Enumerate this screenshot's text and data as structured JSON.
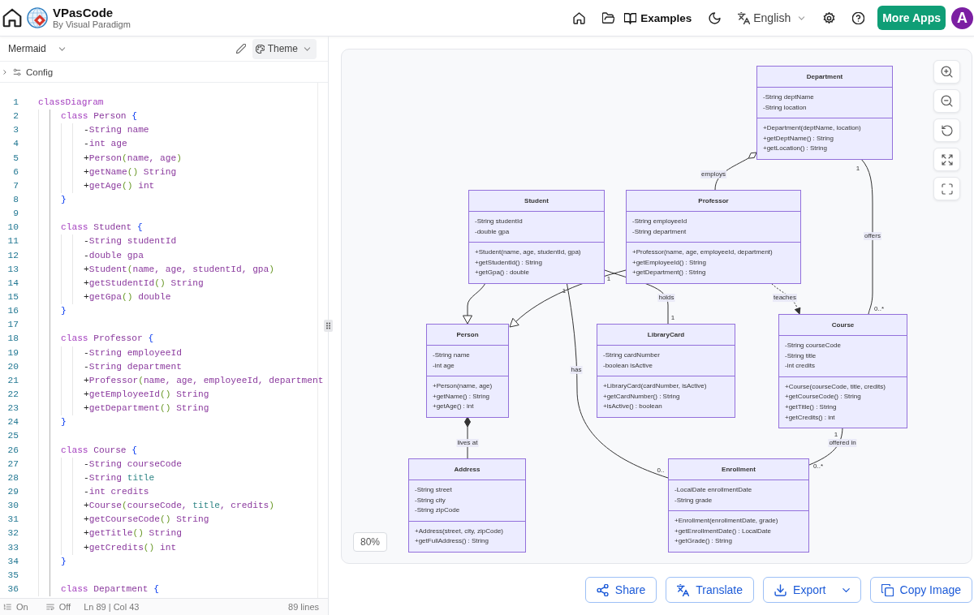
{
  "header": {
    "app_name": "VPasCode",
    "byline": "By Visual Paradigm",
    "examples": "Examples",
    "language": "English",
    "more_apps": "More Apps",
    "avatar": "A"
  },
  "editor": {
    "syntax": "Mermaid",
    "theme": "Theme",
    "config": {
      "label": "Config",
      "expanded": false
    },
    "lines": [
      {
        "number": "1",
        "tokens": [
          {
            "kind": "keyword",
            "text": "classDiagram"
          }
        ],
        "children": [
          {
            "number": "2",
            "tokens": [
              {
                "kind": "keyword",
                "text": "class"
              },
              {
                "kind": "identifier",
                "text": " Person "
              },
              {
                "kind": "brace",
                "text": "{"
              }
            ],
            "children": [
              {
                "number": "3",
                "tokens": [
                  {
                    "kind": "operator",
                    "text": "-"
                  },
                  {
                    "kind": "identifier",
                    "text": "String name"
                  }
                ]
              },
              {
                "number": "4",
                "tokens": [
                  {
                    "kind": "operator",
                    "text": "-"
                  },
                  {
                    "kind": "identifier",
                    "text": "int age"
                  }
                ]
              },
              {
                "number": "5",
                "tokens": [
                  {
                    "kind": "operator",
                    "text": "+"
                  },
                  {
                    "kind": "identifier",
                    "text": "Person"
                  },
                  {
                    "kind": "paren",
                    "text": "("
                  },
                  {
                    "kind": "identifier",
                    "text": "name, age"
                  },
                  {
                    "kind": "paren",
                    "text": ")"
                  }
                ]
              },
              {
                "number": "6",
                "tokens": [
                  {
                    "kind": "operator",
                    "text": "+"
                  },
                  {
                    "kind": "identifier",
                    "text": "getName"
                  },
                  {
                    "kind": "paren",
                    "text": "()"
                  },
                  {
                    "kind": "identifier",
                    "text": " String"
                  }
                ]
              },
              {
                "number": "7",
                "tokens": [
                  {
                    "kind": "operator",
                    "text": "+"
                  },
                  {
                    "kind": "identifier",
                    "text": "getAge"
                  },
                  {
                    "kind": "paren",
                    "text": "()"
                  },
                  {
                    "kind": "identifier",
                    "text": " int"
                  }
                ]
              }
            ]
          },
          {
            "number": "8",
            "tokens": [
              {
                "kind": "brace",
                "text": "}"
              }
            ]
          },
          {
            "number": "9"
          },
          {
            "number": "10",
            "tokens": [
              {
                "kind": "keyword",
                "text": "class"
              },
              {
                "kind": "identifier",
                "text": " Student "
              },
              {
                "kind": "brace",
                "text": "{"
              }
            ],
            "children": [
              {
                "number": "11",
                "tokens": [
                  {
                    "kind": "operator",
                    "text": "-"
                  },
                  {
                    "kind": "identifier",
                    "text": "String studentId"
                  }
                ]
              },
              {
                "number": "12",
                "tokens": [
                  {
                    "kind": "operator",
                    "text": "-"
                  },
                  {
                    "kind": "identifier",
                    "text": "double gpa"
                  }
                ]
              },
              {
                "number": "13",
                "tokens": [
                  {
                    "kind": "operator",
                    "text": "+"
                  },
                  {
                    "kind": "identifier",
                    "text": "Student"
                  },
                  {
                    "kind": "paren",
                    "text": "("
                  },
                  {
                    "kind": "identifier",
                    "text": "name, age, studentId, gpa"
                  },
                  {
                    "kind": "paren",
                    "text": ")"
                  }
                ]
              },
              {
                "number": "14",
                "tokens": [
                  {
                    "kind": "operator",
                    "text": "+"
                  },
                  {
                    "kind": "identifier",
                    "text": "getStudentId"
                  },
                  {
                    "kind": "paren",
                    "text": "()"
                  },
                  {
                    "kind": "identifier",
                    "text": " String"
                  }
                ]
              },
              {
                "number": "15",
                "tokens": [
                  {
                    "kind": "operator",
                    "text": "+"
                  },
                  {
                    "kind": "identifier",
                    "text": "getGpa"
                  },
                  {
                    "kind": "paren",
                    "text": "()"
                  },
                  {
                    "kind": "identifier",
                    "text": " double"
                  }
                ]
              }
            ]
          },
          {
            "number": "16",
            "tokens": [
              {
                "kind": "brace",
                "text": "}"
              }
            ]
          },
          {
            "number": "17"
          },
          {
            "number": "18",
            "tokens": [
              {
                "kind": "keyword",
                "text": "class"
              },
              {
                "kind": "identifier",
                "text": " Professor "
              },
              {
                "kind": "brace",
                "text": "{"
              }
            ],
            "children": [
              {
                "number": "19",
                "tokens": [
                  {
                    "kind": "operator",
                    "text": "-"
                  },
                  {
                    "kind": "identifier",
                    "text": "String employeeId"
                  }
                ]
              },
              {
                "number": "20",
                "tokens": [
                  {
                    "kind": "operator",
                    "text": "-"
                  },
                  {
                    "kind": "identifier",
                    "text": "String department"
                  }
                ]
              },
              {
                "number": "21",
                "tokens": [
                  {
                    "kind": "operator",
                    "text": "+"
                  },
                  {
                    "kind": "identifier",
                    "text": "Professor"
                  },
                  {
                    "kind": "paren",
                    "text": "("
                  },
                  {
                    "kind": "identifier",
                    "text": "name, age, employeeId, department"
                  }
                ]
              },
              {
                "number": "22",
                "tokens": [
                  {
                    "kind": "operator",
                    "text": "+"
                  },
                  {
                    "kind": "identifier",
                    "text": "getEmployeeId"
                  },
                  {
                    "kind": "paren",
                    "text": "()"
                  },
                  {
                    "kind": "identifier",
                    "text": " String"
                  }
                ]
              },
              {
                "number": "23",
                "tokens": [
                  {
                    "kind": "operator",
                    "text": "+"
                  },
                  {
                    "kind": "identifier",
                    "text": "getDepartment"
                  },
                  {
                    "kind": "paren",
                    "text": "()"
                  },
                  {
                    "kind": "identifier",
                    "text": " String"
                  }
                ]
              }
            ]
          },
          {
            "number": "24",
            "tokens": [
              {
                "kind": "brace",
                "text": "}"
              }
            ]
          },
          {
            "number": "25"
          },
          {
            "number": "26",
            "tokens": [
              {
                "kind": "keyword",
                "text": "class"
              },
              {
                "kind": "identifier",
                "text": " Course "
              },
              {
                "kind": "brace",
                "text": "{"
              }
            ],
            "children": [
              {
                "number": "27",
                "tokens": [
                  {
                    "kind": "operator",
                    "text": "-"
                  },
                  {
                    "kind": "identifier",
                    "text": "String courseCode"
                  }
                ]
              },
              {
                "number": "28",
                "tokens": [
                  {
                    "kind": "operator",
                    "text": "-"
                  },
                  {
                    "kind": "identifier",
                    "text": "String "
                  },
                  {
                    "kind": "property",
                    "text": "title"
                  }
                ]
              },
              {
                "number": "29",
                "tokens": [
                  {
                    "kind": "operator",
                    "text": "-"
                  },
                  {
                    "kind": "identifier",
                    "text": "int credits"
                  }
                ]
              },
              {
                "number": "30",
                "tokens": [
                  {
                    "kind": "operator",
                    "text": "+"
                  },
                  {
                    "kind": "identifier",
                    "text": "Course"
                  },
                  {
                    "kind": "paren",
                    "text": "("
                  },
                  {
                    "kind": "identifier",
                    "text": "courseCode, "
                  },
                  {
                    "kind": "property",
                    "text": "title"
                  },
                  {
                    "kind": "identifier",
                    "text": ", credits"
                  },
                  {
                    "kind": "paren",
                    "text": ")"
                  }
                ]
              },
              {
                "number": "31",
                "tokens": [
                  {
                    "kind": "operator",
                    "text": "+"
                  },
                  {
                    "kind": "identifier",
                    "text": "getCourseCode"
                  },
                  {
                    "kind": "paren",
                    "text": "()"
                  },
                  {
                    "kind": "identifier",
                    "text": " String"
                  }
                ]
              },
              {
                "number": "32",
                "tokens": [
                  {
                    "kind": "operator",
                    "text": "+"
                  },
                  {
                    "kind": "identifier",
                    "text": "getTitle"
                  },
                  {
                    "kind": "paren",
                    "text": "()"
                  },
                  {
                    "kind": "identifier",
                    "text": " String"
                  }
                ]
              },
              {
                "number": "33",
                "tokens": [
                  {
                    "kind": "operator",
                    "text": "+"
                  },
                  {
                    "kind": "identifier",
                    "text": "getCredits"
                  },
                  {
                    "kind": "paren",
                    "text": "()"
                  },
                  {
                    "kind": "identifier",
                    "text": " int"
                  }
                ]
              }
            ]
          },
          {
            "number": "34",
            "tokens": [
              {
                "kind": "brace",
                "text": "}"
              }
            ]
          },
          {
            "number": "35"
          },
          {
            "number": "36",
            "tokens": [
              {
                "kind": "keyword",
                "text": "class"
              },
              {
                "kind": "identifier",
                "text": " Department "
              },
              {
                "kind": "brace",
                "text": "{"
              }
            ]
          }
        ]
      }
    ],
    "status": {
      "line_numbers": "On",
      "word_wrap": "Off",
      "cursor": "Ln 89 | Col 43",
      "line_count": "89 lines"
    }
  },
  "diagram": {
    "nodes": [
      {
        "name": "Department",
        "attributes": [
          "-String deptName",
          "-String location"
        ],
        "methods": [
          "+Department(deptName, location)",
          "+getDeptName() : String",
          "+getLocation() : String"
        ]
      },
      {
        "name": "Student",
        "attributes": [
          "-String studentId",
          "-double gpa"
        ],
        "methods": [
          "+Student(name, age, studentId, gpa)",
          "+getStudentId() : String",
          "+getGpa() : double"
        ]
      },
      {
        "name": "Professor",
        "attributes": [
          "-String employeeId",
          "-String department"
        ],
        "methods": [
          "+Professor(name, age, employeeId, department)",
          "+getEmployeeId() : String",
          "+getDepartment() : String"
        ]
      },
      {
        "name": "Person",
        "attributes": [
          "-String name",
          "-int age"
        ],
        "methods": [
          "+Person(name, age)",
          "+getName() : String",
          "+getAge() : int"
        ]
      },
      {
        "name": "LibraryCard",
        "attributes": [
          "-String cardNumber",
          "-boolean isActive"
        ],
        "methods": [
          "+LibraryCard(cardNumber, isActive)",
          "+getCardNumber() : String",
          "+isActive() : boolean"
        ]
      },
      {
        "name": "Course",
        "attributes": [
          "-String courseCode",
          "-String title",
          "-int credits"
        ],
        "methods": [
          "+Course(courseCode, title, credits)",
          "+getCourseCode() : String",
          "+getTitle() : String",
          "+getCredits() : int"
        ]
      },
      {
        "name": "Address",
        "attributes": [
          "-String street",
          "-String city",
          "-String zipCode"
        ],
        "methods": [
          "+Address(street, city, zipCode)",
          "+getFullAddress() : String"
        ]
      },
      {
        "name": "Enrollment",
        "attributes": [
          "-LocalDate enrollmentDate",
          "-String grade"
        ],
        "methods": [
          "+Enrollment(enrollmentDate, grade)",
          "+getEnrollmentDate() : LocalDate",
          "+getGrade() : String"
        ]
      }
    ],
    "edges": [
      {
        "kind": "aggregation",
        "label": "employs"
      },
      {
        "kind": "association",
        "label": "offers",
        "multiplicity_start": "1",
        "multiplicity_end": "0..*"
      },
      {
        "kind": "inheritance"
      },
      {
        "kind": "association",
        "label": "holds",
        "multiplicity_start": "1",
        "multiplicity_end": "1"
      },
      {
        "kind": "inheritance"
      },
      {
        "kind": "dependency",
        "label": "teaches"
      },
      {
        "kind": "association",
        "label": "has",
        "multiplicity_start": "1",
        "multiplicity_end": "0.."
      },
      {
        "kind": "composition",
        "label": "lives at"
      },
      {
        "kind": "association",
        "label": "offered in",
        "multiplicity_start": "1",
        "multiplicity_end": "0..*"
      }
    ],
    "zoom": "80%"
  },
  "actions": [
    {
      "kind": "share",
      "label": "Share",
      "dropdown": false
    },
    {
      "kind": "translate",
      "label": "Translate",
      "dropdown": false
    },
    {
      "kind": "export",
      "label": "Export",
      "dropdown": true
    },
    {
      "kind": "copy",
      "label": "Copy Image",
      "dropdown": false
    }
  ]
}
